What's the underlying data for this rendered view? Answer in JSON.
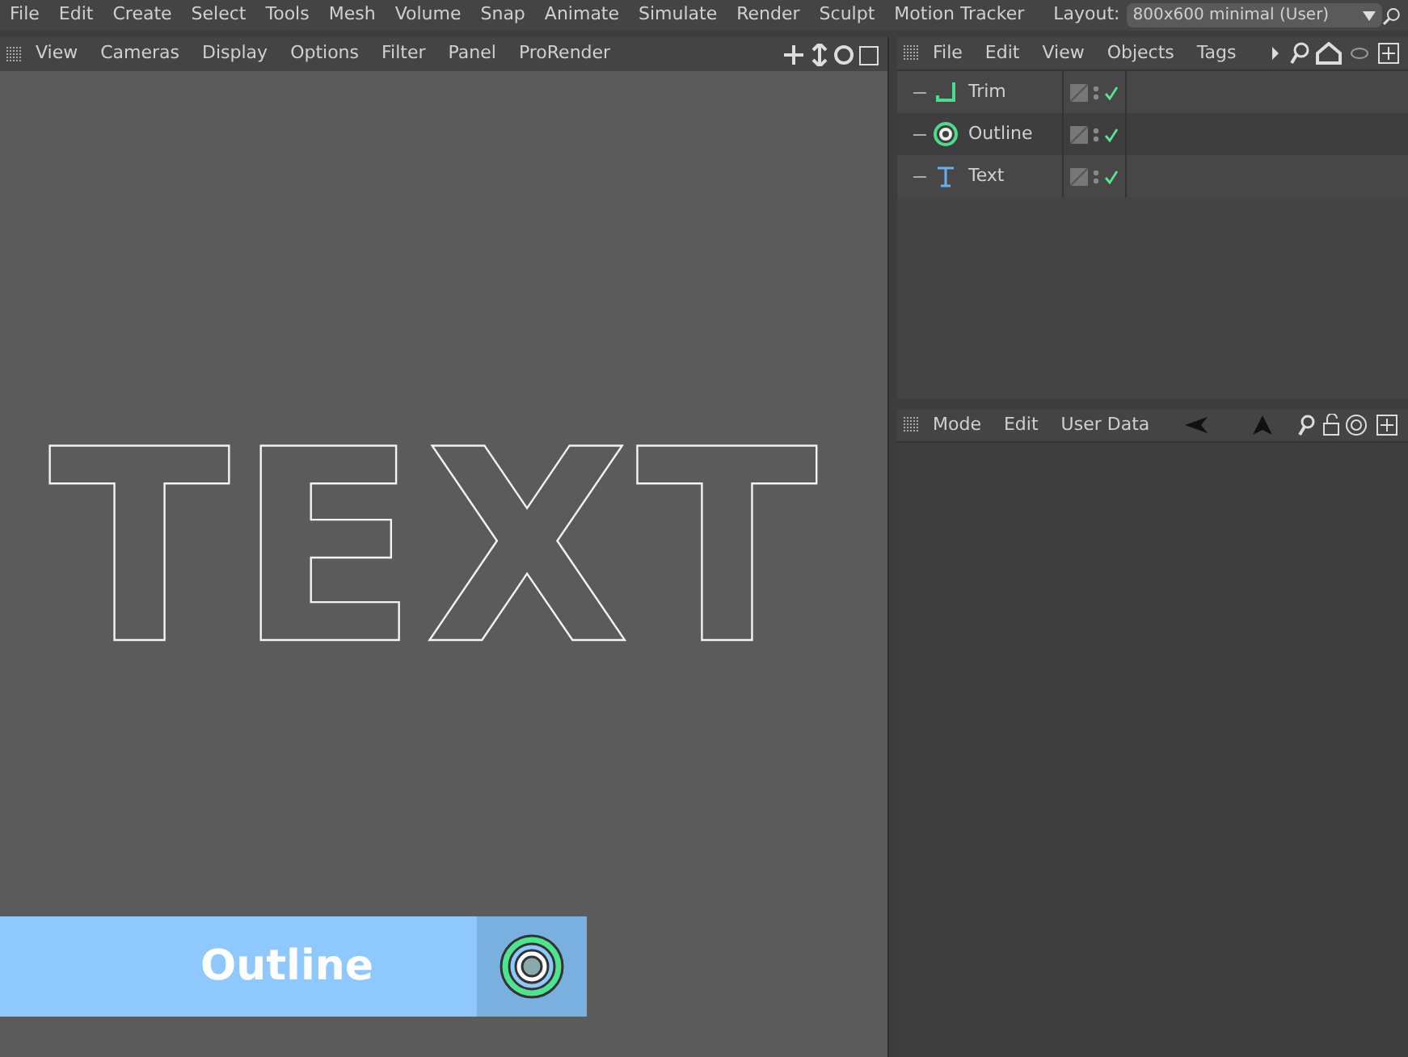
{
  "menu_bar": {
    "items": [
      "File",
      "Edit",
      "Create",
      "Select",
      "Tools",
      "Mesh",
      "Volume",
      "Snap",
      "Animate",
      "Simulate",
      "Render",
      "Sculpt",
      "Motion Tracker"
    ],
    "layout_label": "Layout:",
    "layout_value": "800x600 minimal (User)"
  },
  "viewport": {
    "menu": [
      "View",
      "Cameras",
      "Display",
      "Options",
      "Filter",
      "Panel",
      "ProRender"
    ],
    "rendered_text": "TEXT"
  },
  "object_manager": {
    "menu": [
      "File",
      "Edit",
      "View",
      "Objects",
      "Tags"
    ],
    "objects": [
      {
        "name": "Trim",
        "kind": "trim",
        "enabled": true
      },
      {
        "name": "Outline",
        "kind": "outline",
        "enabled": true
      },
      {
        "name": "Text",
        "kind": "text",
        "enabled": true
      }
    ]
  },
  "attribute_manager": {
    "menu": [
      "Mode",
      "Edit",
      "User Data"
    ]
  },
  "caption": {
    "label": "Outline"
  }
}
